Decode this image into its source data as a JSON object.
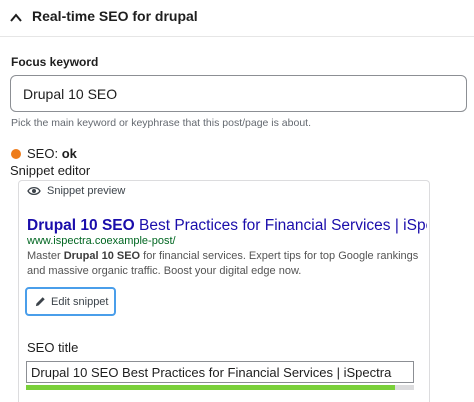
{
  "panel": {
    "title": "Real-time SEO for drupal",
    "toggle_icon": "chevron-up-icon"
  },
  "focus_keyword": {
    "label": "Focus keyword",
    "value": "Drupal 10 SEO",
    "help": "Pick the main keyword or keyphrase that this post/page is about."
  },
  "seo_status": {
    "label": "SEO:",
    "value": "ok",
    "color": "#ee7c1b"
  },
  "snippet_editor": {
    "label": "Snippet editor",
    "preview_label": "Snippet preview",
    "preview_icon": "eye-icon",
    "serp": {
      "title_keyword": "Drupal 10 SEO",
      "title_rest": " Best Practices for Financial Services | iSpectra",
      "url": "www.ispectra.coexample-post/",
      "desc_prefix": "Master ",
      "desc_keyword": "Drupal 10 SEO",
      "desc_rest": " for financial services. Expert tips for top Google rankings and massive organic traffic. Boost your digital edge now."
    },
    "edit_button": "Edit snippet",
    "edit_icon": "pencil-icon",
    "seo_title": {
      "label": "SEO title",
      "value": "Drupal 10 SEO Best Practices for Financial Services | iSpectra",
      "progress_fraction": 0.95,
      "progress_color": "#7ad03a"
    }
  }
}
